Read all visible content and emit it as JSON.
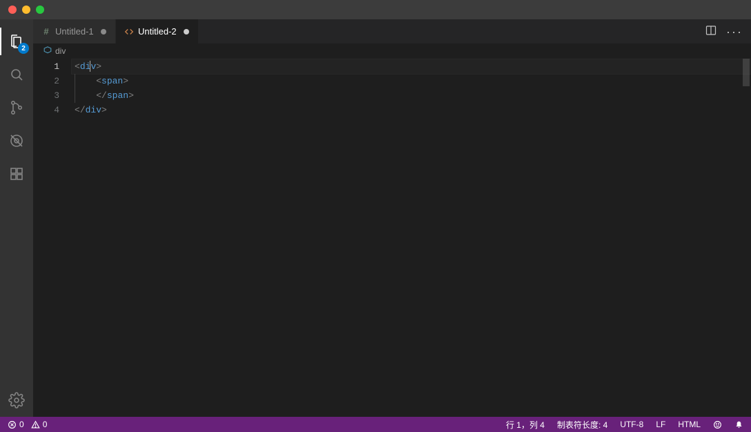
{
  "titlebar": {},
  "activitybar": {
    "badge": "2"
  },
  "tabs": [
    {
      "label": "Untitled-1",
      "icon_label": "#",
      "dirty": true,
      "active": false
    },
    {
      "label": "Untitled-2",
      "icon_label": "<>",
      "dirty": true,
      "active": true
    }
  ],
  "breadcrumbs": {
    "item": "div"
  },
  "editor": {
    "line_numbers": [
      "1",
      "2",
      "3",
      "4"
    ],
    "active_line": 1,
    "code": [
      {
        "indent": 0,
        "open": true,
        "close": false,
        "tag": "div"
      },
      {
        "indent": 1,
        "open": true,
        "close": false,
        "tag": "span"
      },
      {
        "indent": 1,
        "open": false,
        "close": true,
        "tag": "span"
      },
      {
        "indent": 0,
        "open": false,
        "close": true,
        "tag": "div"
      }
    ],
    "cursor": {
      "line": 1,
      "col": 4
    }
  },
  "statusbar": {
    "errors": "0",
    "warnings": "0",
    "cursor_pos": "行 1，列 4",
    "tab_size": "制表符长度: 4",
    "encoding": "UTF-8",
    "eol": "LF",
    "language": "HTML"
  }
}
